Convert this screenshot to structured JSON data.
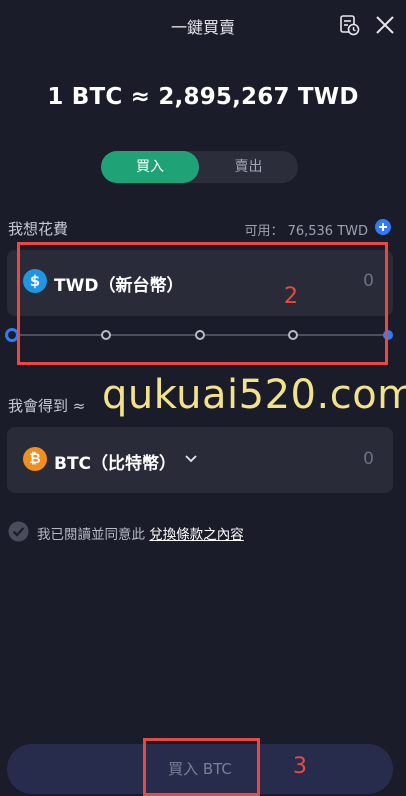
{
  "header": {
    "title": "一鍵買賣"
  },
  "rate": {
    "text": "1 BTC ≈ 2,895,267 TWD"
  },
  "tabs": {
    "buy": "買入",
    "sell": "賣出"
  },
  "spend": {
    "label": "我想花費",
    "available": "可用： 76,536 TWD",
    "currency_symbol": "$",
    "currency": "TWD（新台幣）",
    "amount": "0"
  },
  "slider": {
    "value_percent": 0,
    "stops": 5
  },
  "receive": {
    "label": "我會得到 ≈",
    "currency_symbol": "₿",
    "currency": "BTC（比特幣）",
    "amount": "0"
  },
  "agreement": {
    "text": "我已閱讀並同意此",
    "link": "兌換條款之內容"
  },
  "buy_button": {
    "label": "買入 BTC"
  },
  "annotations": {
    "box2": "2",
    "box3": "3"
  },
  "watermark": "qukuai520.com",
  "colors": {
    "background": "#1b1c29",
    "accent_green": "#1fa275",
    "accent_blue": "#2f7cf6",
    "annotation_red": "#e84a43"
  },
  "icons": {
    "history": "history-icon",
    "close": "close-icon",
    "plus": "plus-circle-icon",
    "twd_coin": "dollar-coin-icon",
    "btc_coin": "bitcoin-coin-icon",
    "chevron": "chevron-down-icon",
    "check": "check-circle-icon"
  }
}
